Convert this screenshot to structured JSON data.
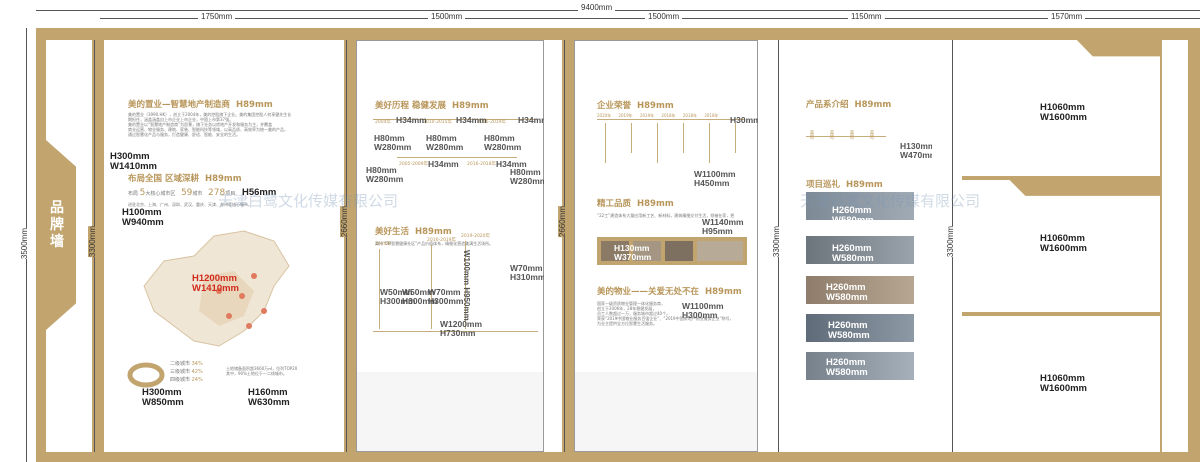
{
  "dims": {
    "total": "9400mm",
    "widths": [
      "1750mm",
      "1500mm",
      "1500mm",
      "1150mm",
      "1570mm"
    ],
    "height_total": "3500mm",
    "height_panel": "3300mm",
    "heights_inner": [
      "3300mm",
      "2660mm",
      "2660mm",
      "3300mm",
      "3300mm"
    ]
  },
  "wall_label": "品牌墙",
  "colors": {
    "gold": "#c2a56e",
    "accent": "#b8965a",
    "red": "#d12a1d"
  },
  "panel1": {
    "s1_title": "美的置业—智慧地产制造商",
    "s1_h": "H89mm",
    "s1_text": [
      "美的置业（3990.HK），创立于2004年，美的控股旗下企业。美的集团控股人何享健先生长",
      "期担任，涵盖涵盖自上市企业上市企业，中国上市第37强。",
      "美的置业以“智慧地产制造商”为愿景，旗下业务以房地产开发和服务为主，并覆盖",
      "商业运营、物业服务、建筑、家装、智能科技等领域，以高品质、高效率为统一美的产品，",
      "通过智慧化产品与服务，打造健康、舒适、智能、安全的生活。"
    ],
    "m1": "H300mm",
    "m2": "W1410mm",
    "s2_title": "布局全国 区域深耕",
    "s2_h": "H89mm",
    "stats_prefix": "布局",
    "stat1": "5",
    "stat1_unit": "大核心城市区",
    "stat2": "59",
    "stat2_unit": "城市",
    "stat3": "278",
    "stat3_unit": "项目",
    "stats_line2": "进驻北京、上海、广州、深圳、武汉、重庆、天津、苏州等核心城市。",
    "m3": "H56mm",
    "m4": "H100mm",
    "m5": "W940mm",
    "map_h": "H1200mm",
    "map_w": "W1410mm",
    "legend": [
      "二级城市",
      "三级城市",
      "四级城市"
    ],
    "legend_vals": [
      "34%",
      "42%",
      "24%"
    ],
    "m6": "H300mm",
    "m7": "W850mm",
    "bottom_text": [
      "土地储备面积超3660万㎡，位列TOP20",
      "其中，90%土地位于一二线城市。"
    ],
    "m8": "H160mm",
    "m9": "W630mm"
  },
  "panel2": {
    "s1_title": "美好历程 稳健发展",
    "s1_h": "H89mm",
    "years": [
      "2004年",
      "2010-2015年",
      "2016-2019年"
    ],
    "h34": "H34mm",
    "years2": [
      "2005-2009年",
      "2016-2018年"
    ],
    "m_a": "H80mm",
    "m_b": "W280mm",
    "s2_title": "美好生活",
    "s2_h": "H89mm",
    "s2_text": "秉持“5M智慧健康社区”产品价值体系，精细化营造美满生活场所。",
    "tl_years": [
      "2014年",
      "2016-2019年",
      "2019-2020年"
    ],
    "m_c": "W50mm",
    "m_d": "H300mm",
    "m_e": "W50mm",
    "m_f": "H300mm",
    "m_g": "W70mm",
    "m_h": "H300mm",
    "m_v": "W100mm H950mm",
    "m_i": "W70mm",
    "m_j": "H310mm",
    "m_k": "W1200mm",
    "m_l": "H730mm"
  },
  "panel3": {
    "s1_title": "企业荣誉",
    "s1_h": "H89mm",
    "years": [
      "2020年",
      "2019年",
      "2019年",
      "2018年",
      "2018年",
      "2018年"
    ],
    "h30": "H30mm",
    "m_a": "W1100mm",
    "m_b": "H450mm",
    "s2_title": "精工品质",
    "s2_h": "H89mm",
    "s2_text": "“22工”建造体系大量应用新工艺、新材料，建筑精细交付生活，领袖在家，把",
    "m_c": "W1140mm",
    "m_d": "H95mm",
    "m_e": "H130mm",
    "m_f": "W370mm",
    "s3_title": "美的物业——关爱无处不在",
    "s3_h": "H89mm",
    "m_g": "W1100mm",
    "m_h": "H300mm",
    "s3_text": [
      "国家一级资质物业管理一体化服务商，",
      "创立于2006年，28年稳健发展，",
      "员工人数超过一万，服务城市超过40个。",
      "荣获“2019中国物业服务百强企业”、“2019中国房地产物业服务企业”称号，",
      "为业主提供全方位智慧生活服务。"
    ]
  },
  "panel4": {
    "s1_title": "产品系介绍",
    "s1_h": "H89mm",
    "series": [
      "美的·",
      "美的·",
      "美的·",
      "美的·"
    ],
    "m_a": "H130mm",
    "m_b": "W470mm",
    "s2_title": "项目巡礼",
    "s2_h": "H89mm",
    "photos": [
      {
        "h": "H260mm",
        "w": "W580mm"
      },
      {
        "h": "H260mm",
        "w": "W580mm"
      },
      {
        "h": "H260mm",
        "w": "W580mm"
      },
      {
        "h": "H260mm",
        "w": "W580mm"
      },
      {
        "h": "H260mm",
        "w": "W580mm"
      }
    ]
  },
  "panel5": {
    "boxes": [
      {
        "h": "H1060mm",
        "w": "W1600mm"
      },
      {
        "h": "H1060mm",
        "w": "W1600mm"
      },
      {
        "h": "H1060mm",
        "w": "W1600mm"
      }
    ]
  },
  "watermark1": "天津白鹭文化传媒有限公司",
  "watermark2": "天津白鹭文化传媒有限公司"
}
